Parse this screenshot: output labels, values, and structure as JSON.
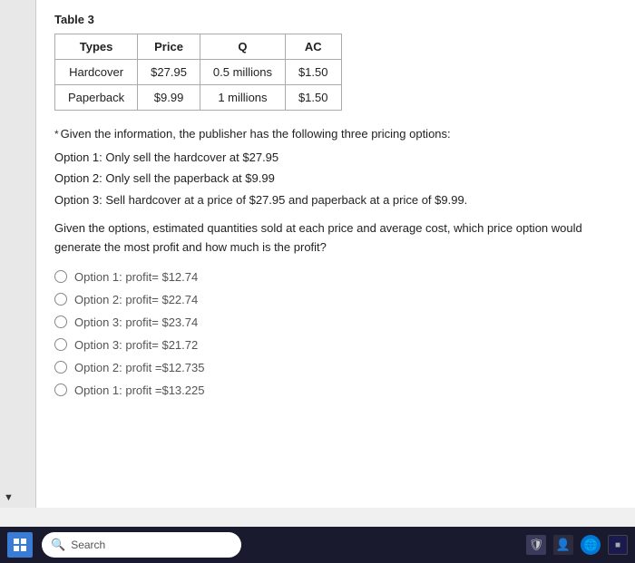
{
  "page": {
    "table": {
      "title": "Table 3",
      "headers": [
        "Types",
        "Price",
        "Q",
        "AC"
      ],
      "rows": [
        [
          "Hardcover",
          "$27.95",
          "0.5 millions",
          "$1.50"
        ],
        [
          "Paperback",
          "$9.99",
          "1 millions",
          "$1.50"
        ]
      ]
    },
    "intro_text": "Given the information, the publisher has the following three pricing options:",
    "options": [
      "Option 1: Only sell the hardcover at $27.95",
      "Option 2: Only sell the paperback at $9.99",
      "Option 3: Sell hardcover at a price of $27.95 and paperback at a price of $9.99."
    ],
    "question": "Given the options, estimated quantities sold at each price and average cost, which price option would generate the most profit and how much is the profit?",
    "radio_options": [
      "Option 1: profit= $12.74",
      "Option 2: profit= $22.74",
      "Option 3: profit= $23.74",
      "Option 3: profit= $21.72",
      "Option 2: profit =$12.735",
      "Option 1: profit =$13.225"
    ]
  },
  "taskbar": {
    "search_placeholder": "Search"
  }
}
